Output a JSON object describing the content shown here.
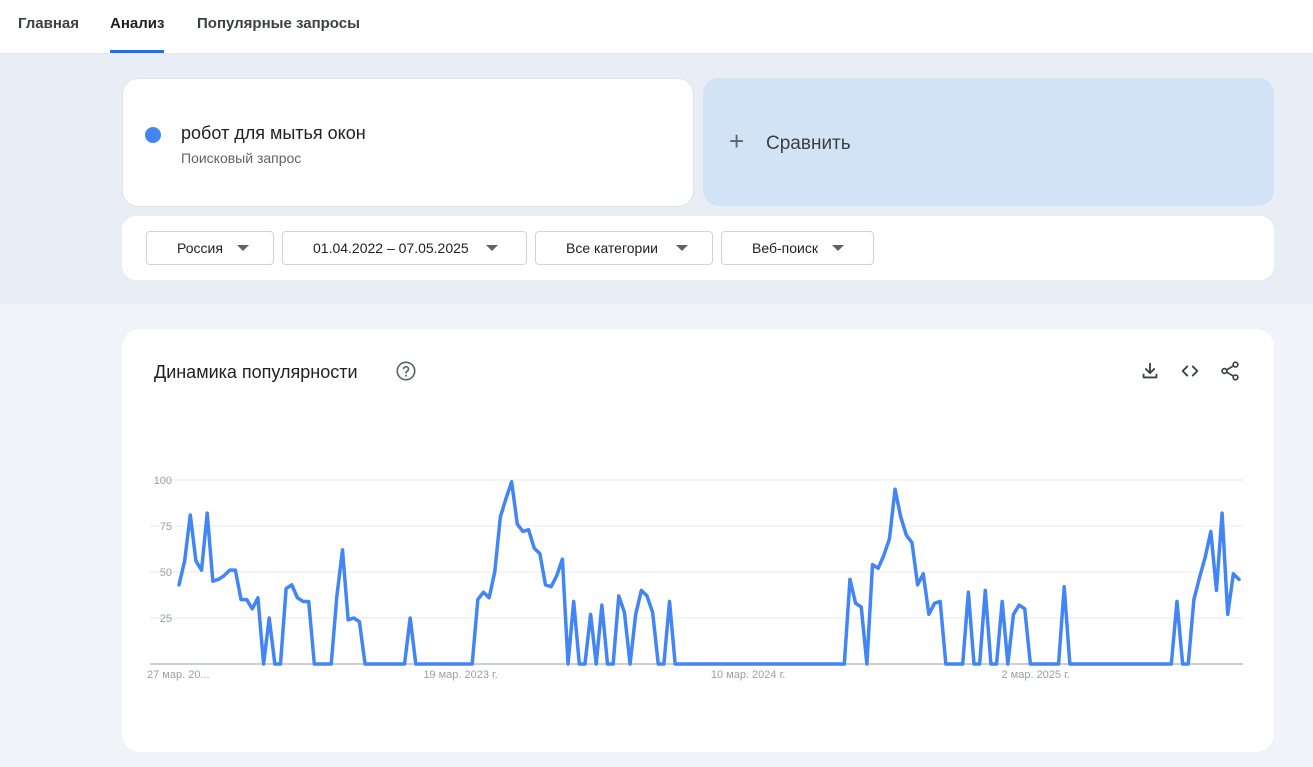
{
  "tabs": [
    {
      "label": "Главная"
    },
    {
      "label": "Анализ"
    },
    {
      "label": "Популярные запросы"
    }
  ],
  "term": {
    "title": "робот для мытья окон",
    "subtitle": "Поисковый запрос",
    "dot_color": "#4285f4"
  },
  "compare": {
    "label": "Сравнить",
    "icon": "plus-icon"
  },
  "filters": {
    "region": "Россия",
    "date_range": "01.04.2022 – 07.05.2025",
    "category": "Все категории",
    "search_type": "Веб-поиск"
  },
  "chart_section": {
    "title": "Динамика популярности",
    "icons": [
      "help-icon",
      "download-icon",
      "embed-icon",
      "share-icon"
    ]
  },
  "chart_data": {
    "type": "line",
    "line_color": "#4285f4",
    "ylim": [
      0,
      100
    ],
    "y_ticks": [
      25,
      50,
      75,
      100
    ],
    "x_tick_labels": [
      "27 мар. 20...",
      "19 мар. 2023 г.",
      "10 мар. 2024 г.",
      "2 мар. 2025 г."
    ],
    "x_tick_positions": [
      0,
      51,
      102,
      153
    ],
    "grid": true,
    "series": [
      {
        "values": [
          43,
          56,
          81,
          56,
          51,
          82,
          45,
          46,
          48,
          51,
          51,
          35,
          35,
          30,
          36,
          0,
          25,
          0,
          0,
          41,
          43,
          36,
          34,
          34,
          0,
          0,
          0,
          0,
          37,
          62,
          24,
          25,
          23,
          0,
          0,
          0,
          0,
          0,
          0,
          0,
          0,
          25,
          0,
          0,
          0,
          0,
          0,
          0,
          0,
          0,
          0,
          0,
          0,
          35,
          39,
          36,
          50,
          80,
          90,
          99,
          76,
          72,
          73,
          63,
          60,
          43,
          42,
          48,
          57,
          0,
          34,
          0,
          0,
          27,
          0,
          32,
          0,
          0,
          37,
          28,
          0,
          27,
          40,
          37,
          28,
          0,
          0,
          34,
          0,
          0,
          0,
          0,
          0,
          0,
          0,
          0,
          0,
          0,
          0,
          0,
          0,
          0,
          0,
          0,
          0,
          0,
          0,
          0,
          0,
          0,
          0,
          0,
          0,
          0,
          0,
          0,
          0,
          0,
          0,
          46,
          33,
          31,
          0,
          54,
          52,
          59,
          68,
          95,
          80,
          70,
          66,
          43,
          49,
          27,
          33,
          34,
          0,
          0,
          0,
          0,
          39,
          0,
          0,
          40,
          0,
          0,
          34,
          0,
          27,
          32,
          30,
          0,
          0,
          0,
          0,
          0,
          0,
          42,
          0,
          0,
          0,
          0,
          0,
          0,
          0,
          0,
          0,
          0,
          0,
          0,
          0,
          0,
          0,
          0,
          0,
          0,
          0,
          34,
          0,
          0,
          35,
          47,
          58,
          72,
          40,
          82,
          27,
          49,
          46
        ]
      }
    ]
  }
}
